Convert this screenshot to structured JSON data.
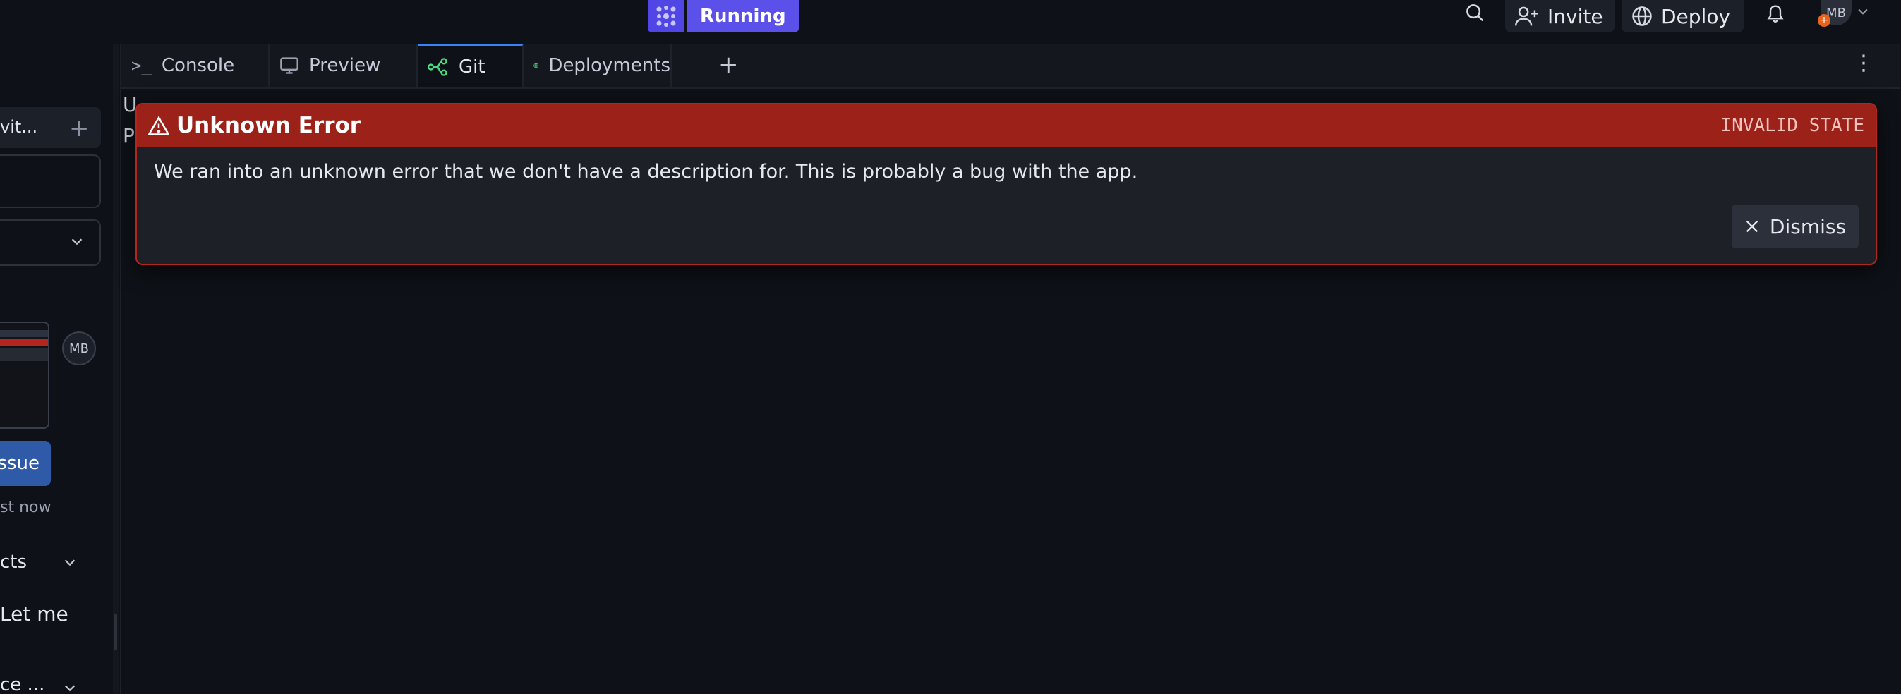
{
  "topbar": {
    "run_label": "Running",
    "invite_label": "Invite",
    "deploy_label": "Deploy",
    "avatar_initials": "MB",
    "avatar_badge": "+"
  },
  "sidebar": {
    "row1_text": "vit...",
    "avatar_initials": "MB",
    "issue_button": "ssue",
    "timestamp": "st now",
    "section_label": "cts",
    "message_text": "Let me",
    "section2_label": "ce ..."
  },
  "tabs": [
    {
      "label": "Console",
      "icon": "terminal-icon"
    },
    {
      "label": "Preview",
      "icon": "monitor-icon"
    },
    {
      "label": "Git",
      "icon": "git-branch-icon"
    },
    {
      "label": "Deployments",
      "icon": "globe-icon"
    }
  ],
  "background": {
    "line1": "U",
    "line2": "P"
  },
  "error": {
    "title": "Unknown Error",
    "code": "INVALID_STATE",
    "message": "We ran into an unknown error that we don't have a description for. This is probably a bug with the app.",
    "dismiss_label": "Dismiss"
  },
  "colors": {
    "accent": "#5b50ea",
    "error_header": "#9b2119",
    "error_border": "#b3261e",
    "background": "#0e1117",
    "active_tab_indicator": "#3b82f6"
  }
}
